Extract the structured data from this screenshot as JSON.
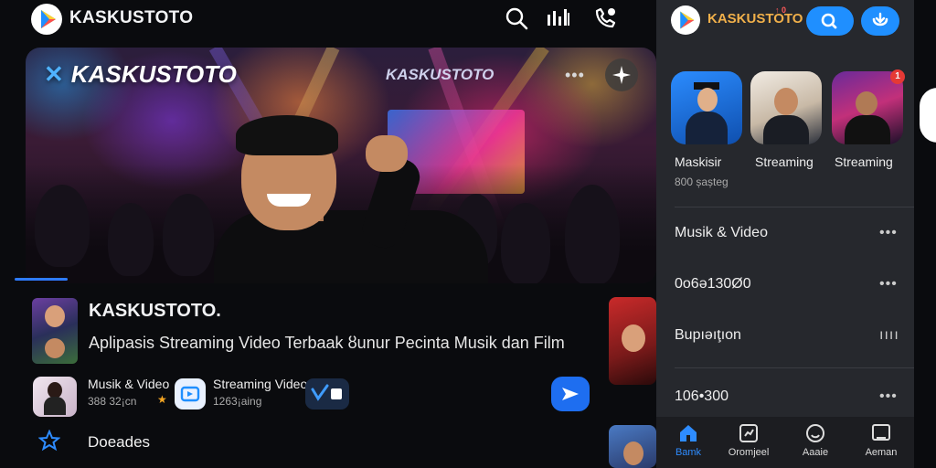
{
  "header": {
    "app_name": "KASKUSTOTO",
    "icons": [
      "search-icon",
      "equalizer-icon",
      "phone-icon"
    ]
  },
  "hero": {
    "brand": "KASKUSTOTO",
    "sign_text": "KASKUSTOTO",
    "more": "•••",
    "badge_icon": "sparkle-icon",
    "progress": 0.1
  },
  "info": {
    "title": "KASKUSTOTO.",
    "subtitle": "Aplipasis Streaming Video Terbaak ȣunur Pecinta Musik dan Film",
    "chips": [
      {
        "label": "Musik & Video",
        "meta": "388 32¡cn"
      },
      {
        "label": "Streaming Video",
        "meta": "1263¡aing"
      }
    ],
    "row_label": "Doeades"
  },
  "panel": {
    "title": "KASKUSTOTO",
    "badge": "↑ 0",
    "apps": [
      {
        "label": "Maskisir",
        "meta": "800 șașteg"
      },
      {
        "label": "Streaming",
        "meta": ""
      },
      {
        "label": "Streaming",
        "meta": ""
      }
    ],
    "app_badge": "1",
    "list": [
      {
        "label": "Musik & Video",
        "more": "•••"
      },
      {
        "label": "0o6ə130Ø0",
        "more": "•••"
      },
      {
        "label": "Bupıəıţıon",
        "more": "ıııı"
      },
      {
        "label": "106•300",
        "more": "•••"
      }
    ],
    "nav": [
      {
        "label": "Bamk"
      },
      {
        "label": "Oromjeel"
      },
      {
        "label": "Aaaie"
      },
      {
        "label": "Aeman"
      }
    ]
  },
  "colors": {
    "accent": "#1f8fff",
    "panel_title": "#f1b04a",
    "background": "#0a0b0e"
  }
}
